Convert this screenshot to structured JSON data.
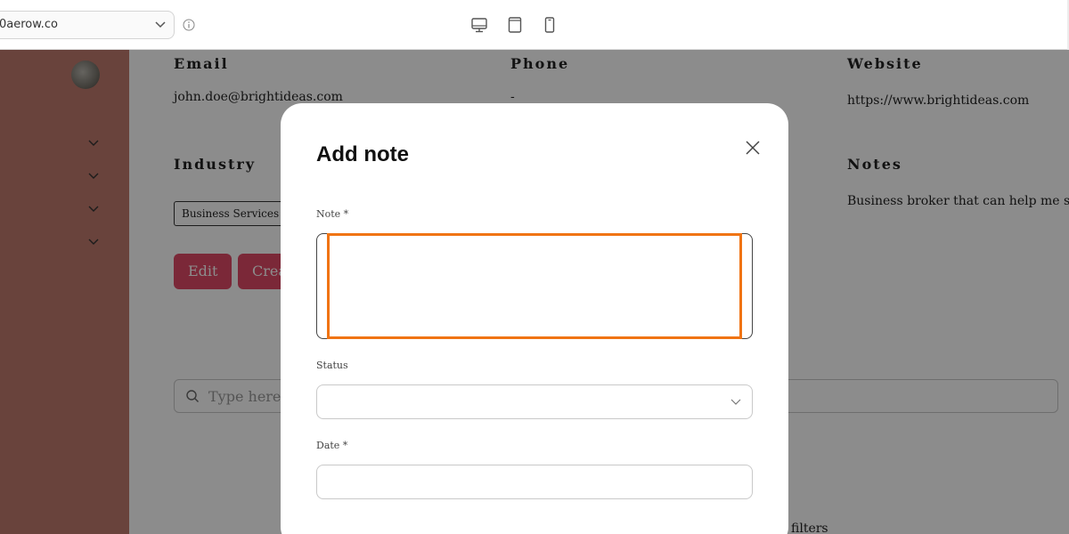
{
  "browser": {
    "url_select_value": "0aerow.co",
    "device_icons": [
      "desktop-icon",
      "tablet-icon",
      "phone-icon"
    ]
  },
  "sidebar": {
    "chevrons": [
      "chevron-down-icon",
      "chevron-down-icon",
      "chevron-down-icon",
      "chevron-down-icon"
    ]
  },
  "contact": {
    "email_label": "Email",
    "email_value": "john.doe@brightideas.com",
    "phone_label": "Phone",
    "phone_value": "-",
    "website_label": "Website",
    "website_value": "https://www.brightideas.com",
    "industry_label": "Industry",
    "industry_tag": "Business Services",
    "notes_label": "Notes",
    "notes_value": "Business broker that can help me sell my b"
  },
  "actions": {
    "edit_label": "Edit",
    "create_label": "Crea"
  },
  "search": {
    "placeholder": "Type here to"
  },
  "footer_text": "filters",
  "modal": {
    "title": "Add note",
    "note_label": "Note *",
    "note_value": "",
    "status_label": "Status",
    "status_value": "",
    "date_label": "Date *",
    "date_value": ""
  },
  "colors": {
    "sidebar": "#c07a6d",
    "accent_button": "#e04a66",
    "focus_ring": "#f07414",
    "overlay": "rgba(0,0,0,0.45)"
  }
}
